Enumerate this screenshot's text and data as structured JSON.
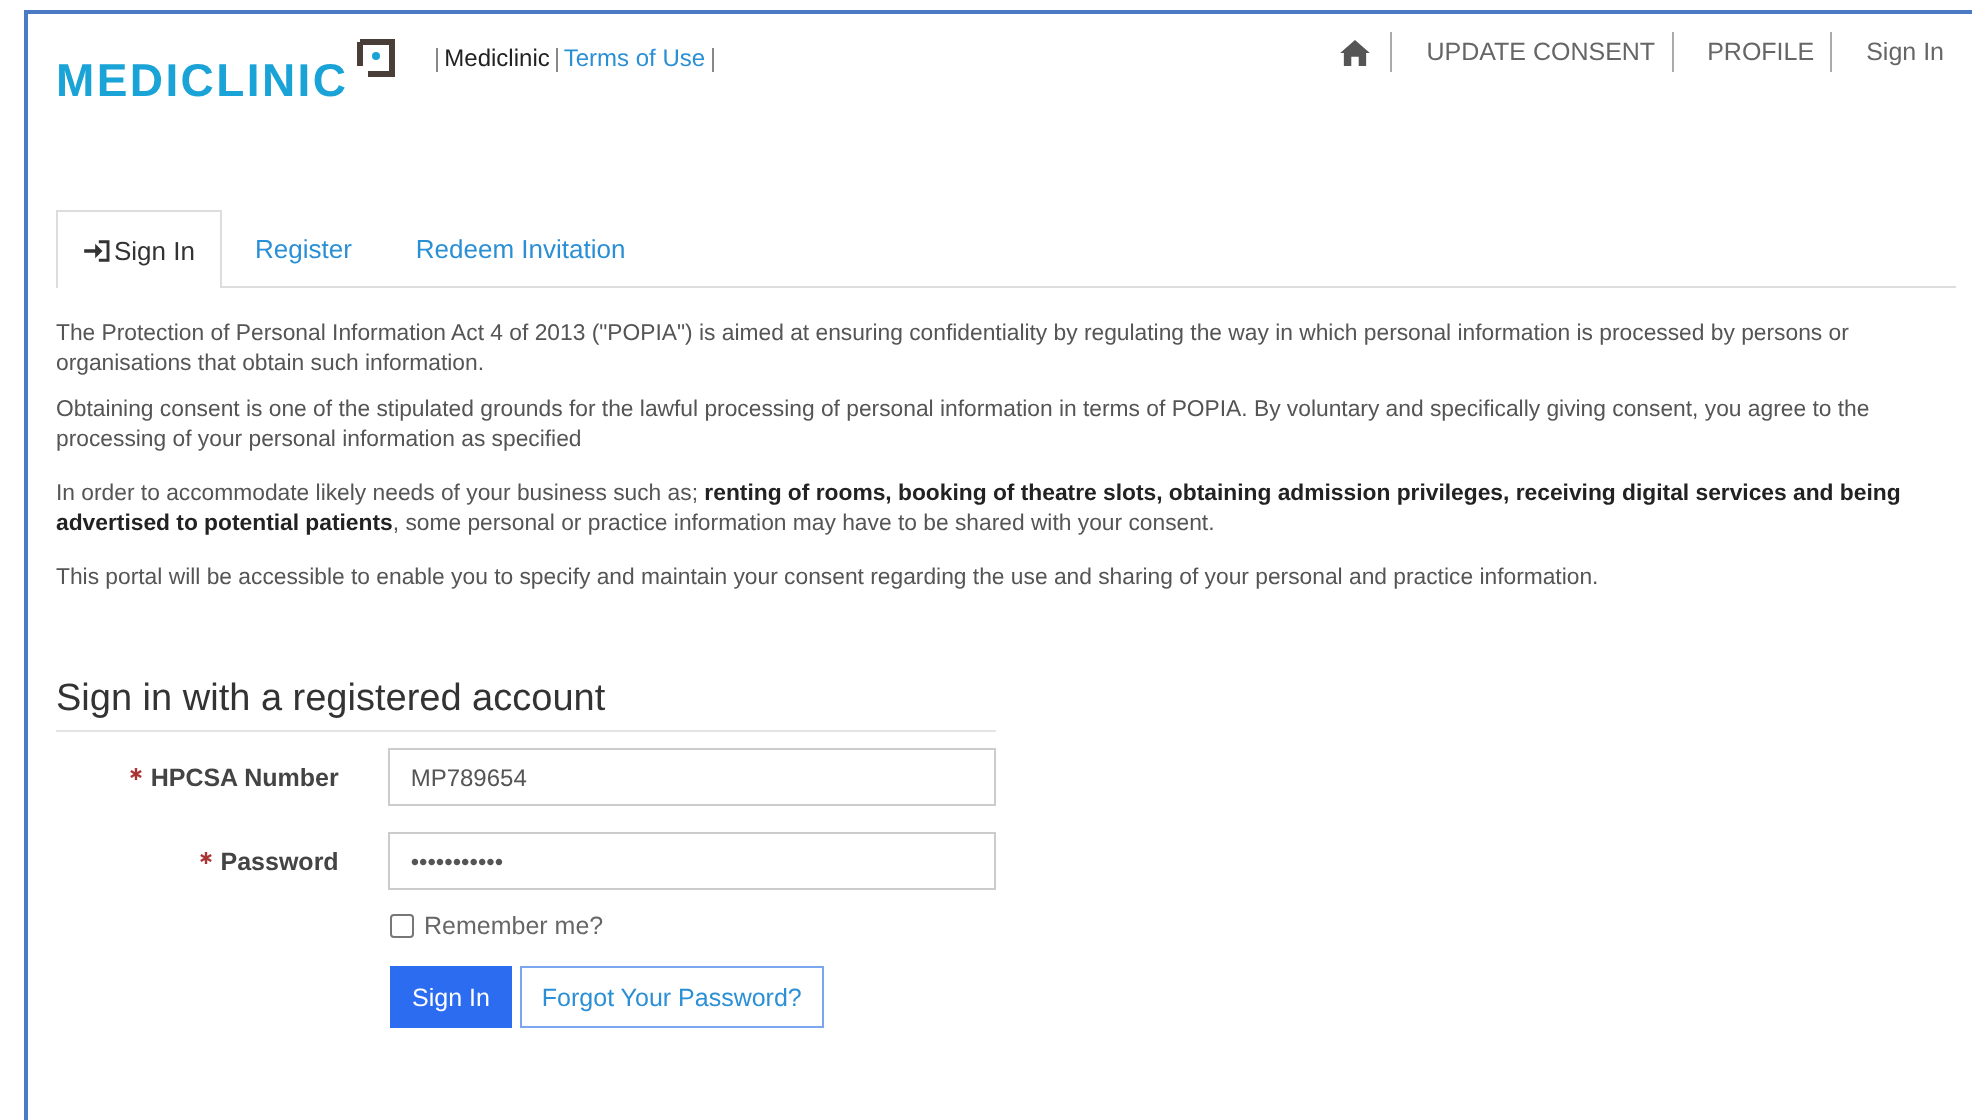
{
  "header": {
    "logo": "MEDICLINIC",
    "links": [
      {
        "label": "Mediclinic",
        "kind": "plain"
      },
      {
        "label": "Terms of Use",
        "kind": "link"
      }
    ],
    "nav": [
      {
        "kind": "home"
      },
      {
        "kind": "text",
        "label": "UPDATE CONSENT"
      },
      {
        "kind": "text",
        "label": "PROFILE"
      },
      {
        "kind": "text",
        "label": "Sign In"
      }
    ]
  },
  "tabs": [
    {
      "label": "Sign In",
      "selected": true,
      "kind": "icon"
    },
    {
      "label": "Register",
      "selected": false
    },
    {
      "label": "Redeem Invitation",
      "selected": false
    }
  ],
  "paragraphs": [
    "The Protection of Personal Information Act 4 of 2013 (\"POPIA\") is aimed at ensuring confidentiality by regulating the way in which personal information is processed by persons or organisations that obtain such information.",
    "Obtaining consent is one of the stipulated grounds for the lawful processing of personal information in terms of POPIA. By voluntary and specifically giving consent, you agree to the processing of your personal information as specified",
    "In order to accommodate likely needs of your business such as; **renting of rooms,  booking of theatre slots, obtaining admission privileges, receiving digital services and being advertised to potential patients**, some personal or practice information may have to be shared with your consent.",
    "This portal will be accessible to enable you to specify and maintain your consent regarding the use and sharing of your personal and practice information."
  ],
  "form": {
    "title": "Sign in with a registered account",
    "fields": [
      {
        "label": "HPCSA Number",
        "required": true,
        "value": "MP789654"
      },
      {
        "label": "Password",
        "required": true,
        "value": "•••••••••••"
      }
    ],
    "remember": {
      "label": "Remember me?",
      "checked": false
    },
    "buttons": [
      {
        "label": "Sign In",
        "kind": "primary"
      },
      {
        "label": "Forgot Your Password?",
        "kind": "secondary"
      }
    ]
  }
}
